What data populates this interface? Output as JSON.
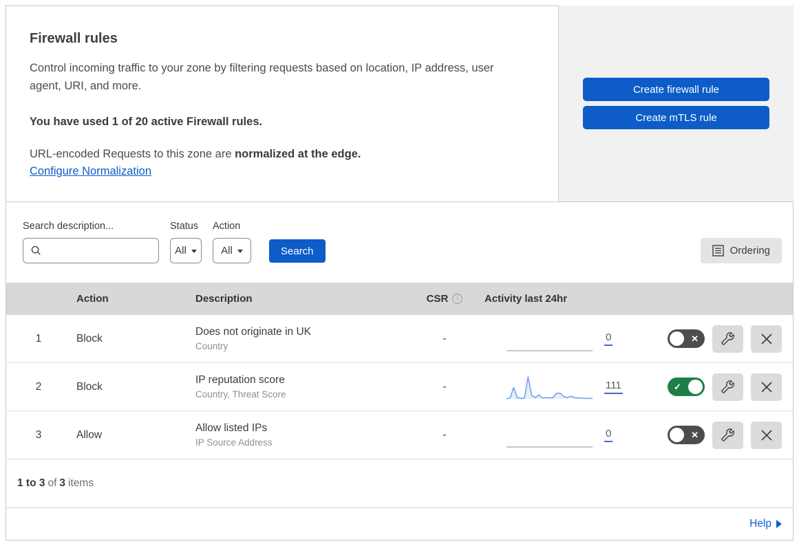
{
  "header": {
    "title": "Firewall rules",
    "description": "Control incoming traffic to your zone by filtering requests based on location, IP address, user agent, URI, and more.",
    "usage": "You have used 1 of 20 active Firewall rules.",
    "normalization_prefix": "URL-encoded Requests to this zone are ",
    "normalization_bold": "normalized at the edge.",
    "normalization_link": "Configure Normalization",
    "create_firewall_label": "Create firewall rule",
    "create_mtls_label": "Create mTLS rule"
  },
  "filters": {
    "search_label": "Search description...",
    "status_label": "Status",
    "status_value": "All",
    "action_label": "Action",
    "action_value": "All",
    "search_button": "Search",
    "ordering_button": "Ordering"
  },
  "table": {
    "columns": {
      "action": "Action",
      "description": "Description",
      "csr": "CSR",
      "activity": "Activity last 24hr"
    },
    "rows": [
      {
        "num": "1",
        "action": "Block",
        "description": "Does not originate in UK",
        "fields": "Country",
        "csr": "-",
        "activity": "0",
        "enabled": false,
        "spark": [
          0,
          0,
          0,
          0,
          0,
          0,
          0,
          0,
          0,
          0,
          0,
          0,
          0,
          0,
          0,
          0,
          0,
          0,
          0,
          0,
          0,
          0,
          0,
          0
        ]
      },
      {
        "num": "2",
        "action": "Block",
        "description": "IP reputation score",
        "fields": "Country, Threat Score",
        "csr": "-",
        "activity": "111",
        "enabled": true,
        "spark": [
          0,
          2,
          26,
          3,
          1,
          2,
          50,
          8,
          3,
          9,
          2,
          3,
          2,
          3,
          13,
          13,
          5,
          3,
          6,
          3,
          2,
          2,
          1,
          1,
          1
        ]
      },
      {
        "num": "3",
        "action": "Allow",
        "description": "Allow listed IPs",
        "fields": "IP Source Address",
        "csr": "-",
        "activity": "0",
        "enabled": false,
        "spark": [
          0,
          0,
          0,
          0,
          0,
          0,
          0,
          0,
          0,
          0,
          0,
          0,
          0,
          0,
          0,
          0,
          0,
          0,
          0,
          0,
          0,
          0,
          0,
          0
        ]
      }
    ]
  },
  "footer": {
    "range": "1 to 3",
    "of": "of",
    "total": "3",
    "items": "items",
    "help": "Help"
  },
  "colors": {
    "accent_blue": "#0d5cc8",
    "toggle_on_green": "#1d7f47",
    "toggle_off_gray": "#4d4d4d",
    "sparkline_blue": "#6f9fe6",
    "panel_gray": "#f1f1f1",
    "table_header_gray": "#d8d8d8"
  }
}
